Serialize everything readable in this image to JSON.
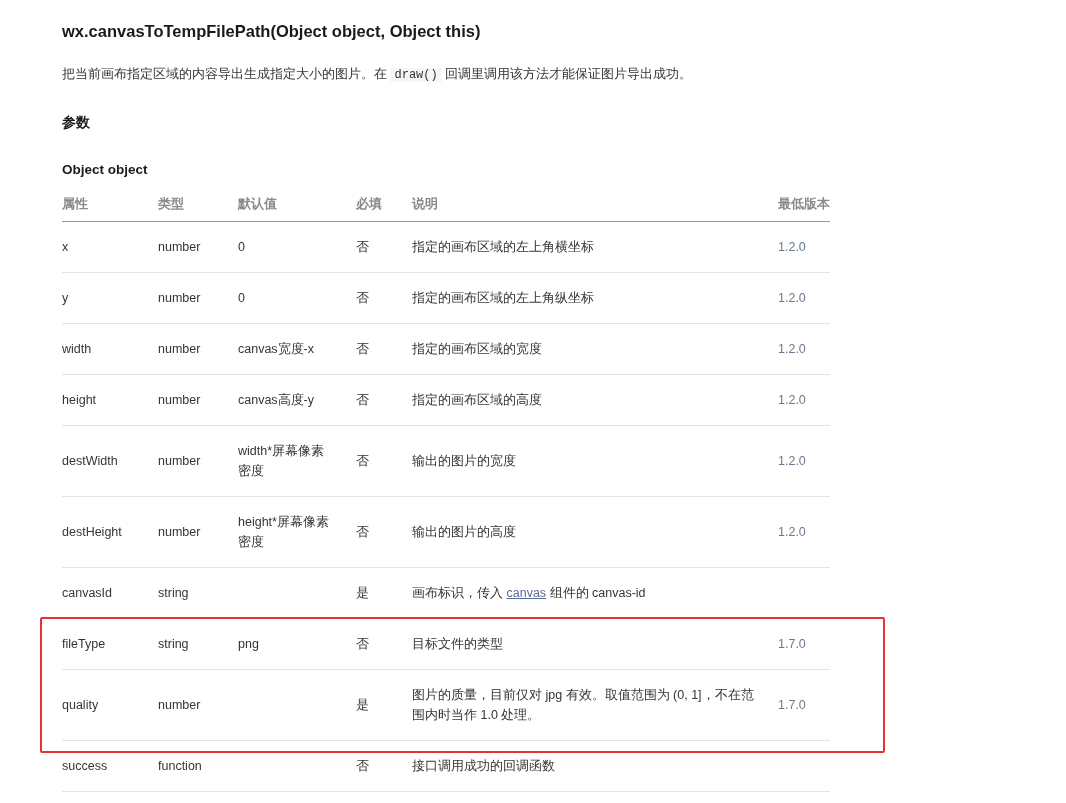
{
  "title": "wx.canvasToTempFilePath(Object object, Object this)",
  "intro": [
    {
      "kind": "text",
      "text": "把当前画布指定区域的内容导出生成指定大小的图片。在 "
    },
    {
      "kind": "code",
      "text": "draw()"
    },
    {
      "kind": "text",
      "text": " 回调里调用该方法才能保证图片导出成功。"
    }
  ],
  "section_heading": "参数",
  "object_heading": "Object object",
  "table": {
    "columns": [
      "属性",
      "类型",
      "默认值",
      "必填",
      "说明",
      "最低版本"
    ],
    "rows": [
      {
        "name": "x",
        "type": "number",
        "default": "0",
        "required": "否",
        "description": [
          {
            "kind": "text",
            "text": "指定的画布区域的左上角横坐标"
          }
        ],
        "version": "1.2.0",
        "highlighted": false
      },
      {
        "name": "y",
        "type": "number",
        "default": "0",
        "required": "否",
        "description": [
          {
            "kind": "text",
            "text": "指定的画布区域的左上角纵坐标"
          }
        ],
        "version": "1.2.0",
        "highlighted": false
      },
      {
        "name": "width",
        "type": "number",
        "default": "canvas宽度-x",
        "required": "否",
        "description": [
          {
            "kind": "text",
            "text": "指定的画布区域的宽度"
          }
        ],
        "version": "1.2.0",
        "highlighted": false
      },
      {
        "name": "height",
        "type": "number",
        "default": "canvas高度-y",
        "required": "否",
        "description": [
          {
            "kind": "text",
            "text": "指定的画布区域的高度"
          }
        ],
        "version": "1.2.0",
        "highlighted": false
      },
      {
        "name": "destWidth",
        "type": "number",
        "default": "width*屏幕像素密度",
        "required": "否",
        "description": [
          {
            "kind": "text",
            "text": "输出的图片的宽度"
          }
        ],
        "version": "1.2.0",
        "highlighted": false
      },
      {
        "name": "destHeight",
        "type": "number",
        "default": "height*屏幕像素密度",
        "required": "否",
        "description": [
          {
            "kind": "text",
            "text": "输出的图片的高度"
          }
        ],
        "version": "1.2.0",
        "highlighted": false
      },
      {
        "name": "canvasId",
        "type": "string",
        "required": "是",
        "description": [
          {
            "kind": "text",
            "text": "画布标识，传入 "
          },
          {
            "kind": "link",
            "text": "canvas"
          },
          {
            "kind": "text",
            "text": " 组件的 canvas-id"
          }
        ],
        "highlighted": false
      },
      {
        "name": "fileType",
        "type": "string",
        "default": "png",
        "required": "否",
        "description": [
          {
            "kind": "text",
            "text": "目标文件的类型"
          }
        ],
        "version": "1.7.0",
        "highlighted": true
      },
      {
        "name": "quality",
        "type": "number",
        "required": "是",
        "description": [
          {
            "kind": "text",
            "text": "图片的质量，目前仅对 jpg 有效。取值范围为 (0, 1]，不在范围内时当作 1.0 处理。"
          }
        ],
        "version": "1.7.0",
        "highlighted": true
      },
      {
        "name": "success",
        "type": "function",
        "required": "否",
        "description": [
          {
            "kind": "text",
            "text": "接口调用成功的回调函数"
          }
        ],
        "highlighted": false
      }
    ]
  }
}
